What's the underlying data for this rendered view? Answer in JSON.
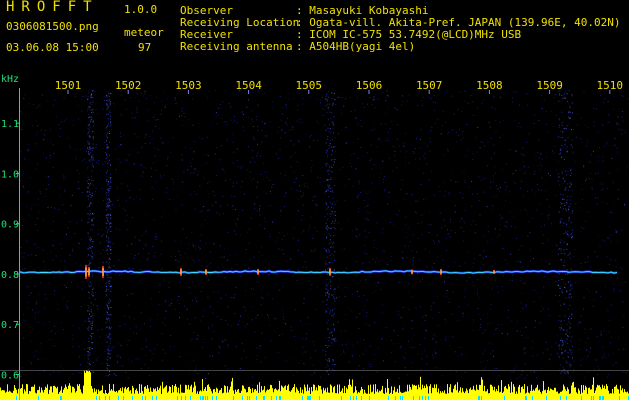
{
  "header": {
    "app_name": "HROFFT",
    "app_version": "1.0.0",
    "file_name": "0306081500.png",
    "datetime": "03.06.08 15:00",
    "meteor_label": "meteor",
    "meteor_count": "97",
    "info": [
      {
        "label": "Observer",
        "value": ": Masayuki Kobayashi"
      },
      {
        "label": "Receiving Location",
        "value": ": Ogata-vill. Akita-Pref. JAPAN (139.96E, 40.02N)"
      },
      {
        "label": "Receiver",
        "value": ": ICOM IC-575 53.7492(@LCD)MHz USB"
      },
      {
        "label": "Receiving antenna",
        "value": ": A504HB(yagi 4el)"
      }
    ]
  },
  "spectrogram": {
    "freq_unit": "kHz",
    "freq_ticks": [
      "1.1",
      "1.0",
      "0.9",
      "0.8",
      "0.7",
      "0.6"
    ],
    "freq_tick_values": [
      1.1,
      1.0,
      0.9,
      0.8,
      0.7,
      0.6
    ],
    "time_ticks": [
      "1501",
      "1502",
      "1503",
      "1504",
      "1505",
      "1506",
      "1507",
      "1508",
      "1509",
      "1510"
    ],
    "freq_range": [
      0.585,
      1.17
    ],
    "carrier_freq": 0.804,
    "colors": {
      "background": "#000000",
      "noise": "#1a2090",
      "carrier": "#40e0ff",
      "activity_bars": "#ffff00",
      "activity_base": "#00e0ff",
      "axis_text": "#1ee07a"
    }
  }
}
